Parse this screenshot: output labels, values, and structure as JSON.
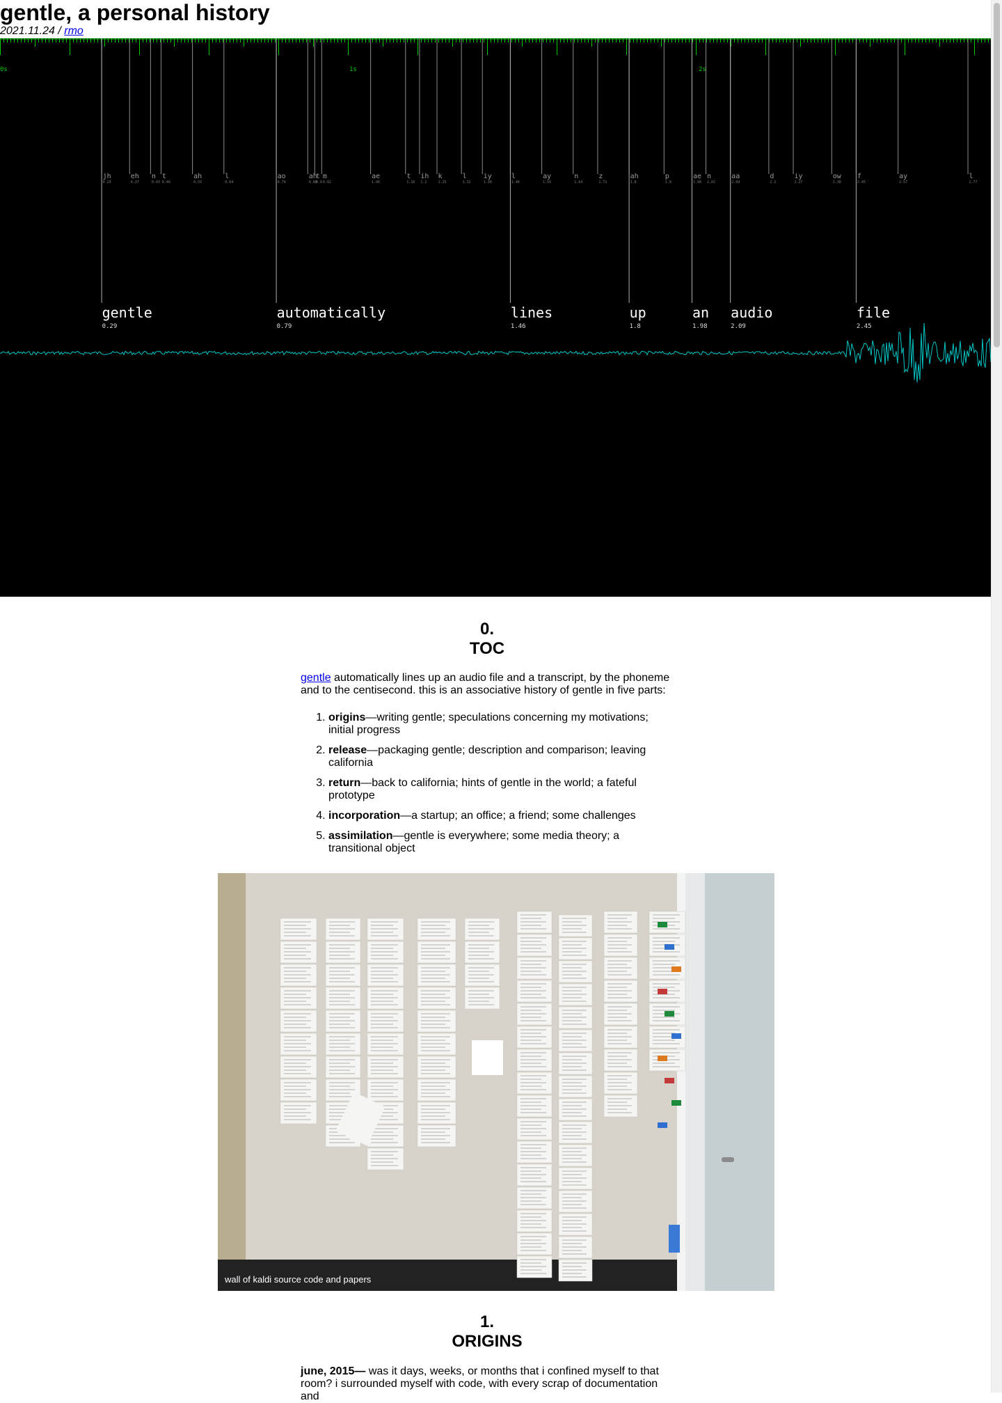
{
  "header": {
    "title": "gentle, a personal history",
    "date": "2021.11.24",
    "separator": " / ",
    "author": "rmo"
  },
  "alignment_viz": {
    "colors": {
      "background": "#000000",
      "ticks": "#00cc00",
      "lines": "#8a8a8a",
      "text": "#ffffff",
      "waveform": "#00c8c8"
    },
    "time_labels": [
      "0s",
      "1s",
      "2s"
    ],
    "phonemes": [
      {
        "p": "jh",
        "t": "0.29"
      },
      {
        "p": "eh",
        "t": "0.37"
      },
      {
        "p": "n",
        "t": "0.43"
      },
      {
        "p": "t",
        "t": "0.46"
      },
      {
        "p": "ah",
        "t": "0.55"
      },
      {
        "p": "l",
        "t": "0.64"
      },
      {
        "p": "ao",
        "t": "0.79"
      },
      {
        "p": "t",
        "t": "0.9"
      },
      {
        "p": "ah",
        "t": "0.88"
      },
      {
        "p": "m",
        "t": "0.92"
      },
      {
        "p": "ae",
        "t": "1.06"
      },
      {
        "p": "t",
        "t": "1.16"
      },
      {
        "p": "ih",
        "t": "1.2"
      },
      {
        "p": "k",
        "t": "1.25"
      },
      {
        "p": "l",
        "t": "1.32"
      },
      {
        "p": "iy",
        "t": "1.38"
      },
      {
        "p": "l",
        "t": "1.46"
      },
      {
        "p": "ay",
        "t": "1.55"
      },
      {
        "p": "n",
        "t": "1.64"
      },
      {
        "p": "z",
        "t": "1.71"
      },
      {
        "p": "ah",
        "t": "1.8"
      },
      {
        "p": "p",
        "t": "1.9"
      },
      {
        "p": "ae",
        "t": "1.98"
      },
      {
        "p": "n",
        "t": "2.02"
      },
      {
        "p": "aa",
        "t": "2.09"
      },
      {
        "p": "d",
        "t": "2.2"
      },
      {
        "p": "iy",
        "t": "2.27"
      },
      {
        "p": "ow",
        "t": "2.38"
      },
      {
        "p": "f",
        "t": "2.45"
      },
      {
        "p": "ay",
        "t": "2.57"
      },
      {
        "p": "l",
        "t": "2.77"
      }
    ],
    "words": [
      {
        "w": "gentle",
        "t": "0.29"
      },
      {
        "w": "automatically",
        "t": "0.79"
      },
      {
        "w": "lines",
        "t": "1.46"
      },
      {
        "w": "up",
        "t": "1.8"
      },
      {
        "w": "an",
        "t": "1.98"
      },
      {
        "w": "audio",
        "t": "2.09"
      },
      {
        "w": "file",
        "t": "2.45"
      }
    ]
  },
  "toc": {
    "number": "0.",
    "heading": "TOC",
    "intro_link": "gentle",
    "intro_text": " automatically lines up an audio file and a transcript, by the phoneme and to the centisecond. this is an associative history of gentle in five parts:",
    "items": [
      {
        "title": "origins",
        "desc": "—writing gentle; speculations concerning my motivations; initial progress"
      },
      {
        "title": "release",
        "desc": "—packaging gentle; description and comparison; leaving california"
      },
      {
        "title": "return",
        "desc": "—back to california; hints of gentle in the world; a fateful prototype"
      },
      {
        "title": "incorporation",
        "desc": "—a startup; an office; a friend; some challenges"
      },
      {
        "title": "assimilation",
        "desc": "—gentle is everywhere; some media theory; a transitional object"
      }
    ]
  },
  "photo": {
    "caption": "wall of kaldi source code and papers"
  },
  "origins": {
    "number": "1.",
    "heading": "ORIGINS",
    "date_lead": "june, 2015—",
    "text": " was it days, weeks, or months that i confined myself to that room? i surrounded myself with code, with every scrap of documentation and"
  }
}
